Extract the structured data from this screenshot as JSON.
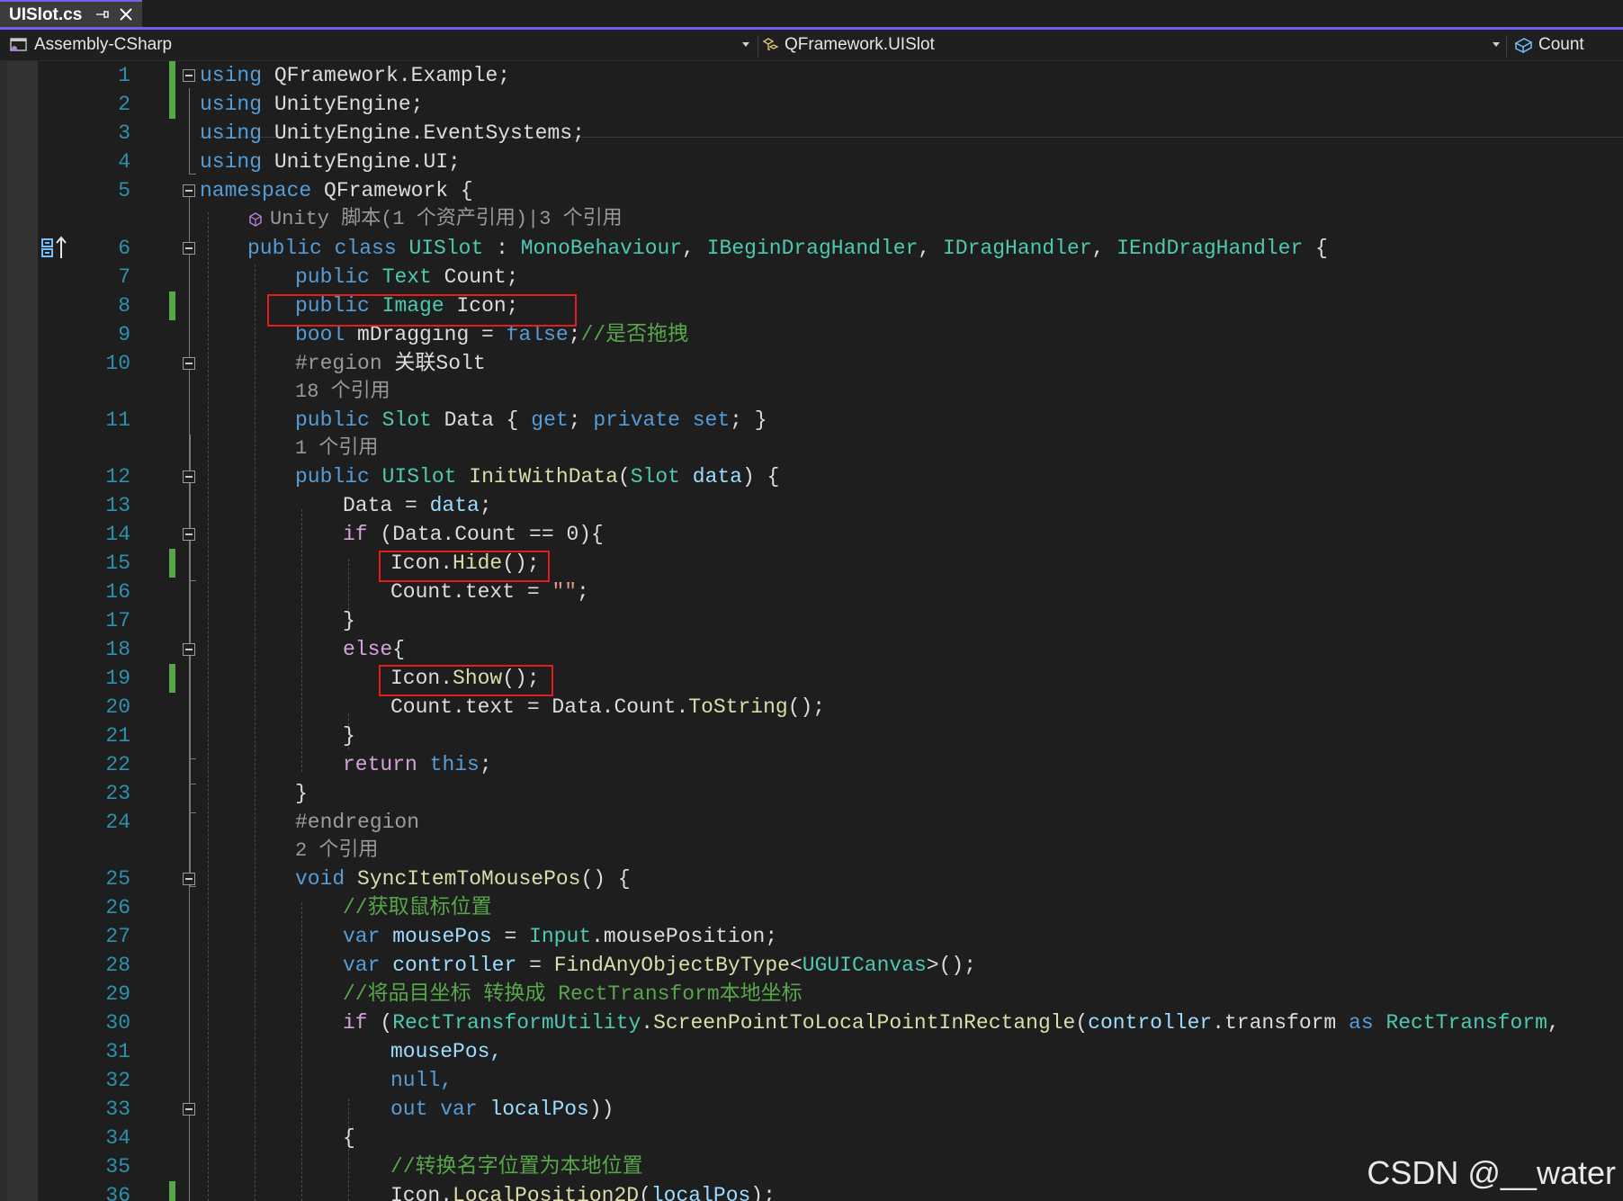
{
  "tab": {
    "title": "UISlot.cs",
    "pin_icon": "pin-icon",
    "close_icon": "close-icon"
  },
  "nav": {
    "project": "Assembly-CSharp",
    "type": "QFramework.UISlot",
    "member": "Count"
  },
  "watermark": "CSDN @__water",
  "colors": {
    "accent": "#7160e8",
    "change_bar": "#57a64a",
    "highlight_box": "#e31c1c"
  },
  "lines": [
    {
      "n": "1",
      "t": "using QFramework.Example;"
    },
    {
      "n": "2",
      "t": "using UnityEngine;"
    },
    {
      "n": "3",
      "t": "using UnityEngine.EventSystems;"
    },
    {
      "n": "4",
      "t": "using UnityEngine.UI;"
    },
    {
      "n": "5",
      "t": "namespace QFramework {"
    },
    {
      "n": "",
      "t": "Unity 脚本(1 个资产引用)|3 个引用"
    },
    {
      "n": "6",
      "t": "public class UISlot : MonoBehaviour, IBeginDragHandler, IDragHandler, IEndDragHandler {"
    },
    {
      "n": "7",
      "t": "public Text Count;"
    },
    {
      "n": "8",
      "t": "public Image Icon;"
    },
    {
      "n": "9",
      "t": "bool mDragging = false;//是否拖拽"
    },
    {
      "n": "10",
      "t": "#region 关联Solt"
    },
    {
      "n": "",
      "t": "18 个引用"
    },
    {
      "n": "11",
      "t": "public Slot Data { get; private set; }"
    },
    {
      "n": "",
      "t": "1 个引用"
    },
    {
      "n": "12",
      "t": "public UISlot InitWithData(Slot data) {"
    },
    {
      "n": "13",
      "t": "Data = data;"
    },
    {
      "n": "14",
      "t": "if (Data.Count == 0){"
    },
    {
      "n": "15",
      "t": "Icon.Hide();"
    },
    {
      "n": "16",
      "t": "Count.text = \"\";"
    },
    {
      "n": "17",
      "t": "}"
    },
    {
      "n": "18",
      "t": "else{"
    },
    {
      "n": "19",
      "t": "Icon.Show();"
    },
    {
      "n": "20",
      "t": "Count.text = Data.Count.ToString();"
    },
    {
      "n": "21",
      "t": "}"
    },
    {
      "n": "22",
      "t": "return this;"
    },
    {
      "n": "23",
      "t": "}"
    },
    {
      "n": "24",
      "t": "#endregion"
    },
    {
      "n": "",
      "t": "2 个引用"
    },
    {
      "n": "25",
      "t": "void SyncItemToMousePos() {"
    },
    {
      "n": "26",
      "t": "//获取鼠标位置"
    },
    {
      "n": "27",
      "t": "var mousePos = Input.mousePosition;"
    },
    {
      "n": "28",
      "t": "var controller = FindAnyObjectByType<UGUICanvas>();"
    },
    {
      "n": "29",
      "t": "//将品目坐标 转换成 RectTransform本地坐标"
    },
    {
      "n": "30",
      "t": "if (RectTransformUtility.ScreenPointToLocalPointInRectangle(controller.transform as RectTransform,"
    },
    {
      "n": "31",
      "t": "mousePos,"
    },
    {
      "n": "32",
      "t": "null,"
    },
    {
      "n": "33",
      "t": "out var localPos))"
    },
    {
      "n": "34",
      "t": "{"
    },
    {
      "n": "35",
      "t": "//转换名字位置为本地位置"
    },
    {
      "n": "36",
      "t": "Icon.LocalPosition2D(localPos);"
    }
  ]
}
